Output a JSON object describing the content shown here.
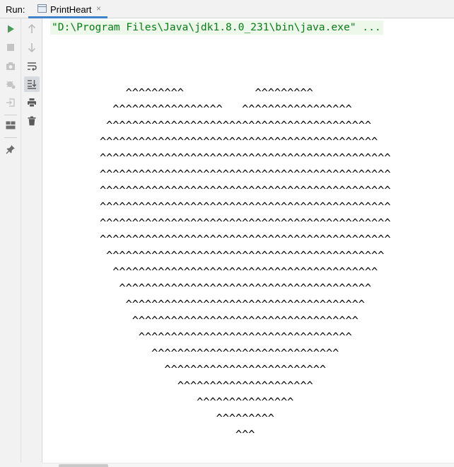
{
  "header": {
    "run_label": "Run:",
    "tab_title": "PrintHeart",
    "tab_close": "×"
  },
  "toolbar_left": [
    {
      "name": "rerun-icon"
    },
    {
      "name": "stop-icon"
    },
    {
      "name": "dump-threads-camera-icon"
    },
    {
      "name": "settings-bug-icon"
    },
    {
      "name": "exit-icon"
    },
    {
      "name": "layout-icon"
    },
    {
      "name": "pin-icon"
    }
  ],
  "toolbar_right": [
    {
      "name": "up-arrow-icon"
    },
    {
      "name": "down-arrow-icon"
    },
    {
      "name": "soft-wrap-icon"
    },
    {
      "name": "scroll-to-end-icon",
      "active": true
    },
    {
      "name": "print-icon"
    },
    {
      "name": "trash-icon"
    }
  ],
  "console": {
    "command_line": "\"D:\\Program Files\\Java\\jdk1.8.0_231\\bin\\java.exe\" ...",
    "output_lines": [
      "    ^^^^^^^^^           ^^^^^^^^^",
      "  ^^^^^^^^^^^^^^^^^   ^^^^^^^^^^^^^^^^^",
      " ^^^^^^^^^^^^^^^^^^^^^^^^^^^^^^^^^^^^^^^^^",
      "^^^^^^^^^^^^^^^^^^^^^^^^^^^^^^^^^^^^^^^^^^^",
      "^^^^^^^^^^^^^^^^^^^^^^^^^^^^^^^^^^^^^^^^^^^^^",
      "^^^^^^^^^^^^^^^^^^^^^^^^^^^^^^^^^^^^^^^^^^^^^",
      "^^^^^^^^^^^^^^^^^^^^^^^^^^^^^^^^^^^^^^^^^^^^^",
      "^^^^^^^^^^^^^^^^^^^^^^^^^^^^^^^^^^^^^^^^^^^^^",
      "^^^^^^^^^^^^^^^^^^^^^^^^^^^^^^^^^^^^^^^^^^^^^",
      "^^^^^^^^^^^^^^^^^^^^^^^^^^^^^^^^^^^^^^^^^^^^^",
      " ^^^^^^^^^^^^^^^^^^^^^^^^^^^^^^^^^^^^^^^^^^^",
      "  ^^^^^^^^^^^^^^^^^^^^^^^^^^^^^^^^^^^^^^^^^",
      "   ^^^^^^^^^^^^^^^^^^^^^^^^^^^^^^^^^^^^^^^",
      "    ^^^^^^^^^^^^^^^^^^^^^^^^^^^^^^^^^^^^^",
      "     ^^^^^^^^^^^^^^^^^^^^^^^^^^^^^^^^^^^",
      "      ^^^^^^^^^^^^^^^^^^^^^^^^^^^^^^^^^",
      "        ^^^^^^^^^^^^^^^^^^^^^^^^^^^^^",
      "          ^^^^^^^^^^^^^^^^^^^^^^^^^",
      "            ^^^^^^^^^^^^^^^^^^^^^",
      "               ^^^^^^^^^^^^^^^",
      "                  ^^^^^^^^^",
      "                     ^^^"
    ]
  },
  "colors": {
    "accent": "#4083c9",
    "run_green": "#499c54",
    "command_text": "#067d17",
    "command_bg": "#edf7ea"
  }
}
